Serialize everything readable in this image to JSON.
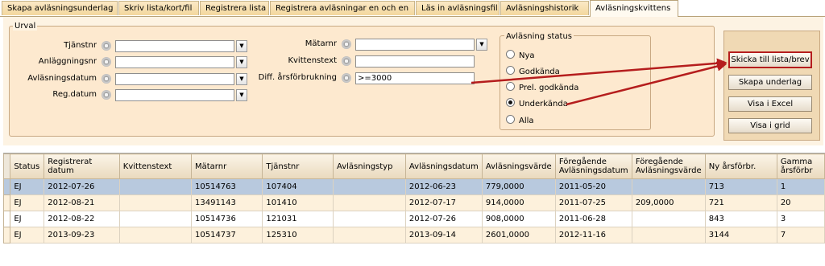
{
  "tabs": [
    {
      "label": "Skapa avläsningsunderlag",
      "active": false
    },
    {
      "label": "Skriv lista/kort/fil",
      "active": false
    },
    {
      "label": "Registrera lista",
      "active": false
    },
    {
      "label": "Registrera avläsningar en och en",
      "active": false
    },
    {
      "label": "Läs in avläsningsfil",
      "active": false
    },
    {
      "label": "Avläsningshistorik",
      "active": false
    },
    {
      "label": "Avläsningskvittens",
      "active": true
    }
  ],
  "urval": {
    "legend": "Urval",
    "left_fields": [
      {
        "label": "Tjänstnr",
        "value": "",
        "has_dropdown": true
      },
      {
        "label": "Anläggningsnr",
        "value": "",
        "has_dropdown": true
      },
      {
        "label": "Avläsningsdatum",
        "value": "",
        "has_dropdown": true
      },
      {
        "label": "Reg.datum",
        "value": "",
        "has_dropdown": true
      }
    ],
    "middle_fields": [
      {
        "label": "Mätarnr",
        "value": "",
        "has_dropdown": true
      },
      {
        "label": "Kvittenstext",
        "value": "",
        "has_dropdown": false
      },
      {
        "label": "Diff. årsförbrukning",
        "value": ">=3000",
        "has_dropdown": false
      }
    ],
    "status": {
      "legend": "Avläsning status",
      "options": [
        {
          "label": "Nya",
          "selected": false
        },
        {
          "label": "Godkända",
          "selected": false
        },
        {
          "label": "Prel. godkända",
          "selected": false
        },
        {
          "label": "Underkända",
          "selected": true
        },
        {
          "label": "Alla",
          "selected": false
        }
      ]
    }
  },
  "buttons": {
    "send": "Skicka till lista/brev",
    "create": "Skapa underlag",
    "excel": "Visa i Excel",
    "grid": "Visa i grid"
  },
  "annotation_color": "#b51d1d",
  "table": {
    "headers": [
      "Status",
      "Registrerat datum",
      "Kvittenstext",
      "Mätarnr",
      "Tjänstnr",
      "Avläsningstyp",
      "Avläsningsdatum",
      "Avläsningsvärde",
      "Föregående Avläsningsdatum",
      "Föregående Avläsningsvärde",
      "Ny årsförbr.",
      "Gamma årsförbr"
    ],
    "rows": [
      [
        "EJ",
        "2012-07-26",
        "",
        "10514763",
        "107404",
        "",
        "2012-06-23",
        "779,0000",
        "2011-05-20",
        "",
        "713",
        "1"
      ],
      [
        "EJ",
        "2012-08-21",
        "",
        "13491143",
        "101410",
        "",
        "2012-07-17",
        "914,0000",
        "2011-07-25",
        "209,0000",
        "721",
        "20"
      ],
      [
        "EJ",
        "2012-08-22",
        "",
        "10514736",
        "121031",
        "",
        "2012-07-26",
        "908,0000",
        "2011-06-28",
        "",
        "843",
        "3"
      ],
      [
        "EJ",
        "2013-09-23",
        "",
        "10514737",
        "125310",
        "",
        "2013-09-14",
        "2601,0000",
        "2012-11-16",
        "",
        "3144",
        "7"
      ]
    ]
  }
}
